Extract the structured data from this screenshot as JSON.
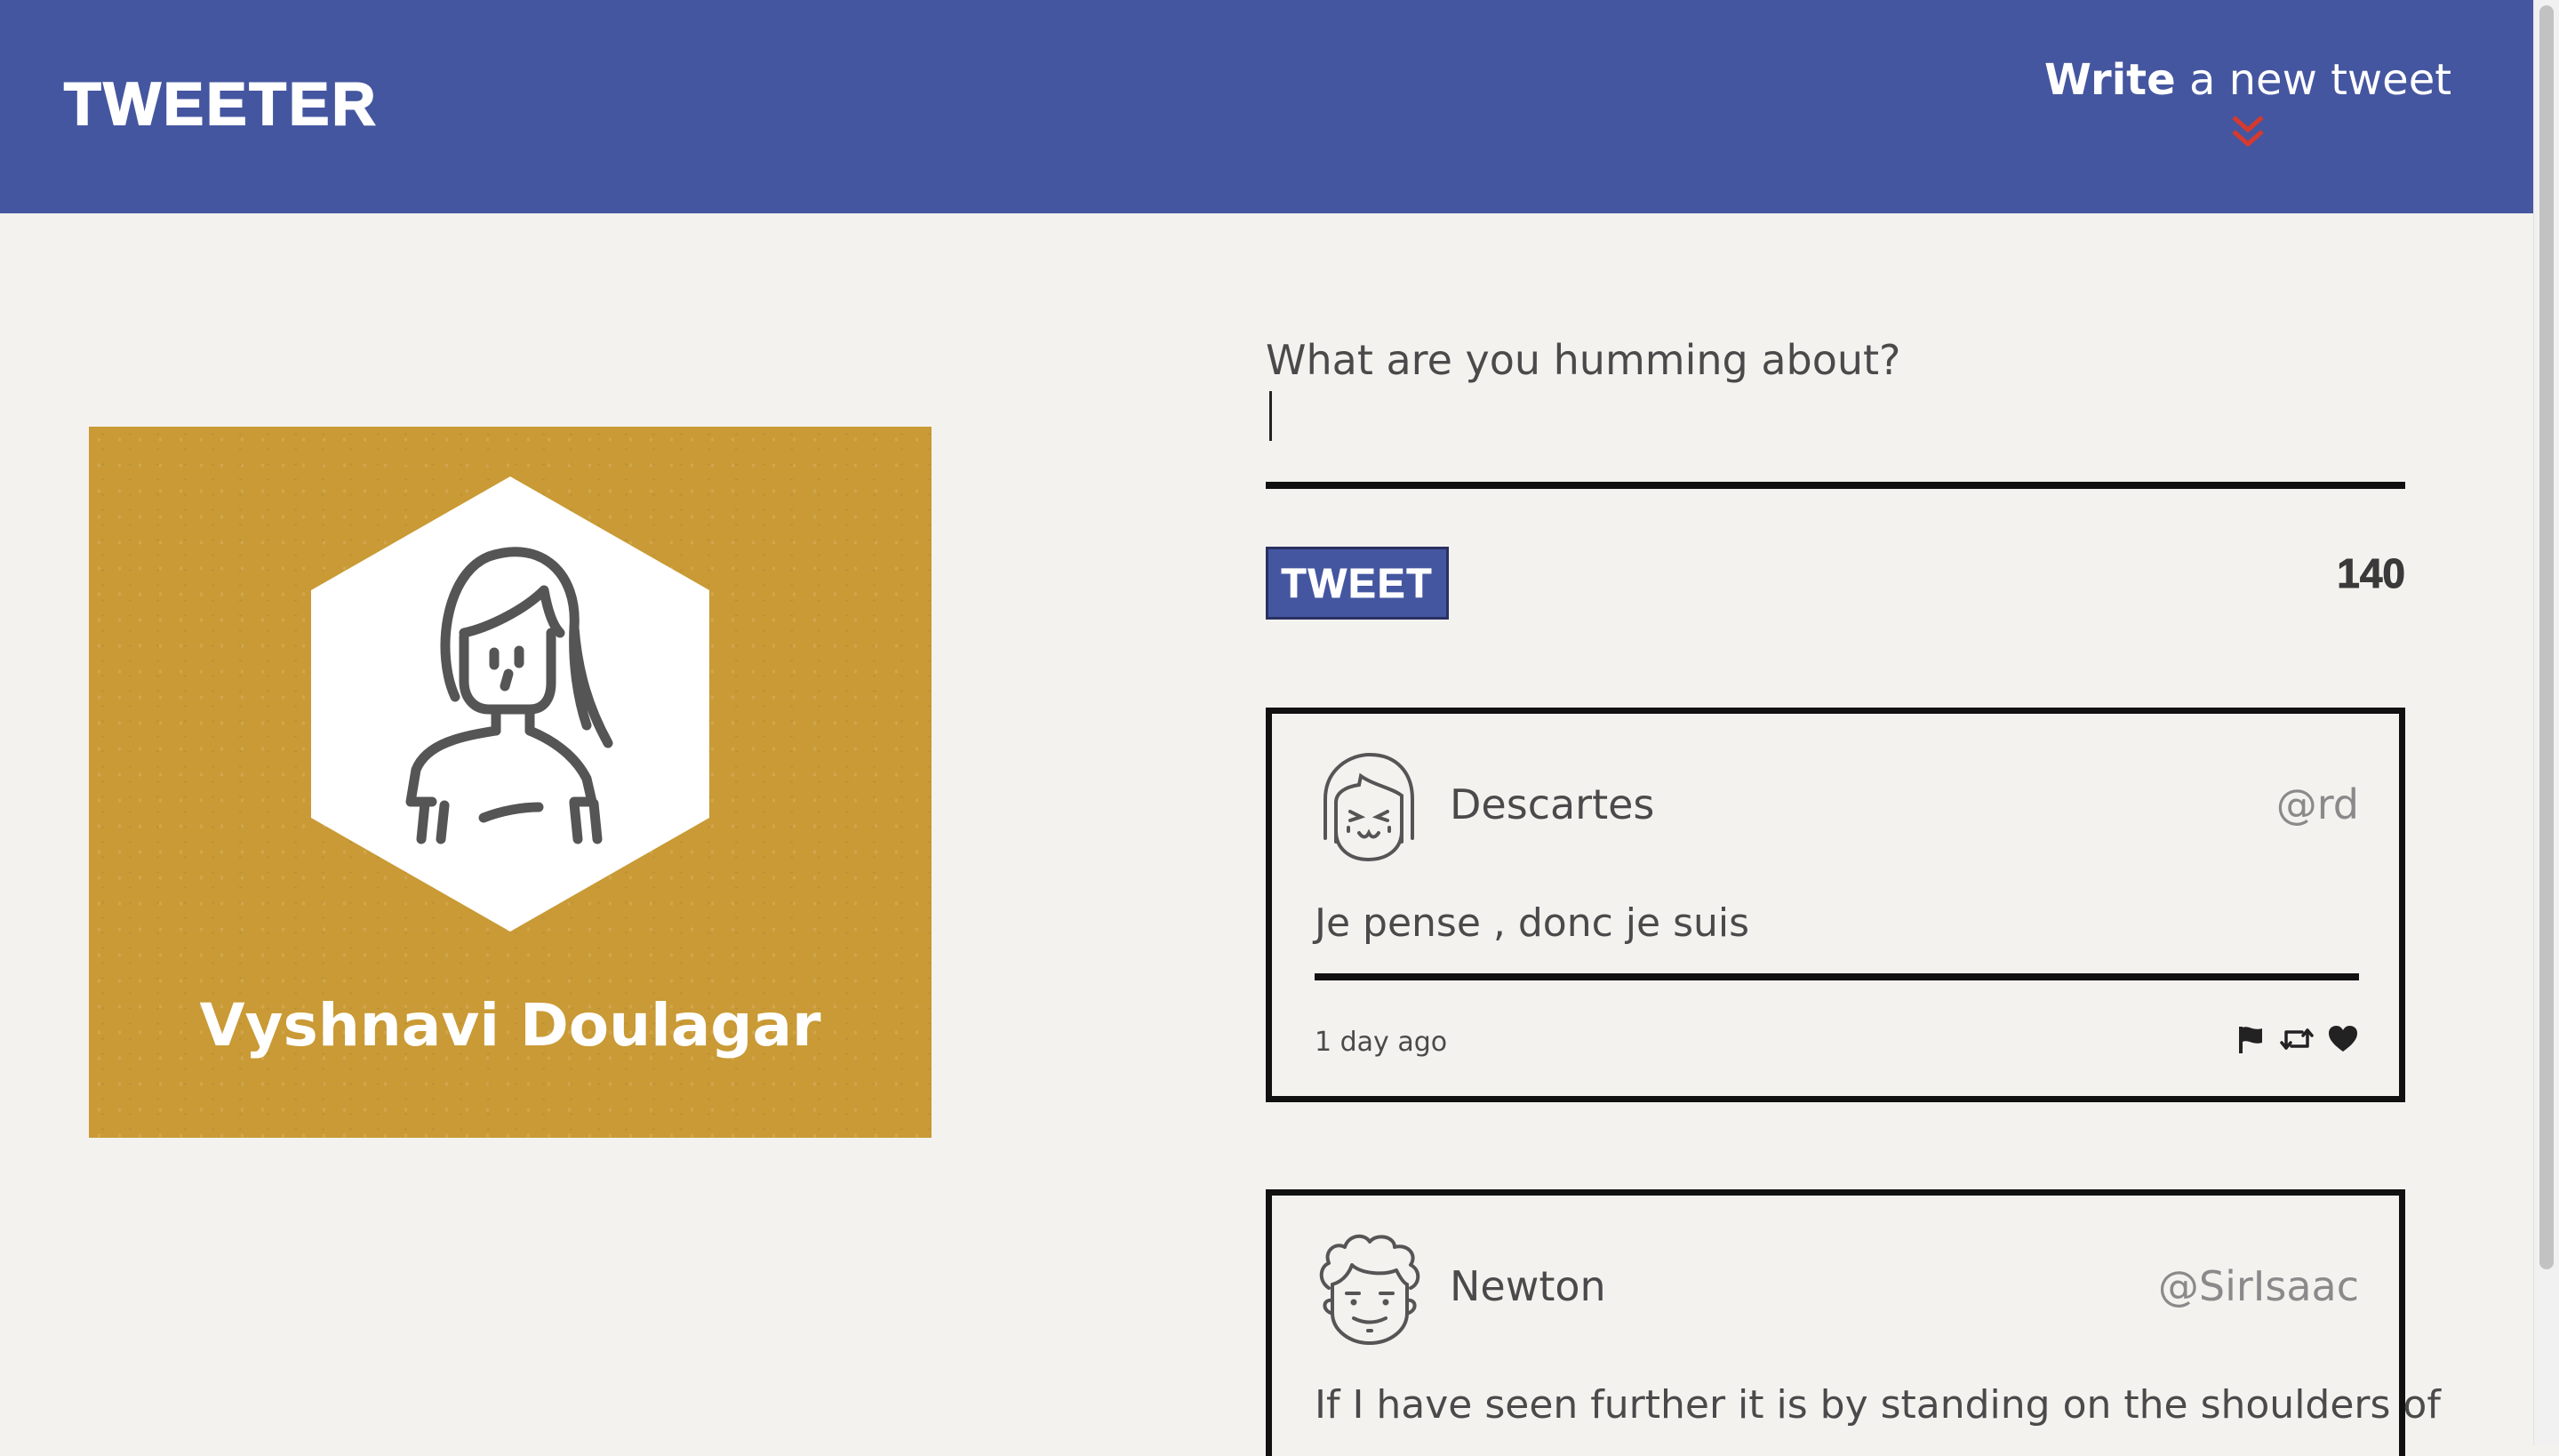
{
  "header": {
    "logo": "TWEETER",
    "compose_toggle_bold": "Write",
    "compose_toggle_rest": " a new tweet"
  },
  "profile": {
    "name": "Vyshnavi Doulagar",
    "avatar_icon": "woman-avatar-icon"
  },
  "composer": {
    "placeholder": "What are you humming about?",
    "value": "",
    "button_label": "TWEET",
    "char_count": "140"
  },
  "tweets": [
    {
      "name": "Descartes",
      "handle": "@rd",
      "body": "Je pense , donc je suis",
      "time": "1 day ago",
      "avatar_icon": "girl-avatar-icon"
    },
    {
      "name": "Newton",
      "handle": "@SirIsaac",
      "body": "If I have seen further it is by standing on the shoulders of",
      "avatar_icon": "curly-hair-avatar-icon"
    }
  ],
  "colors": {
    "nav": "#4556a0",
    "profile_bg": "#c99a35",
    "page_bg": "#f4f2ef",
    "chevron": "#d63a2e"
  }
}
